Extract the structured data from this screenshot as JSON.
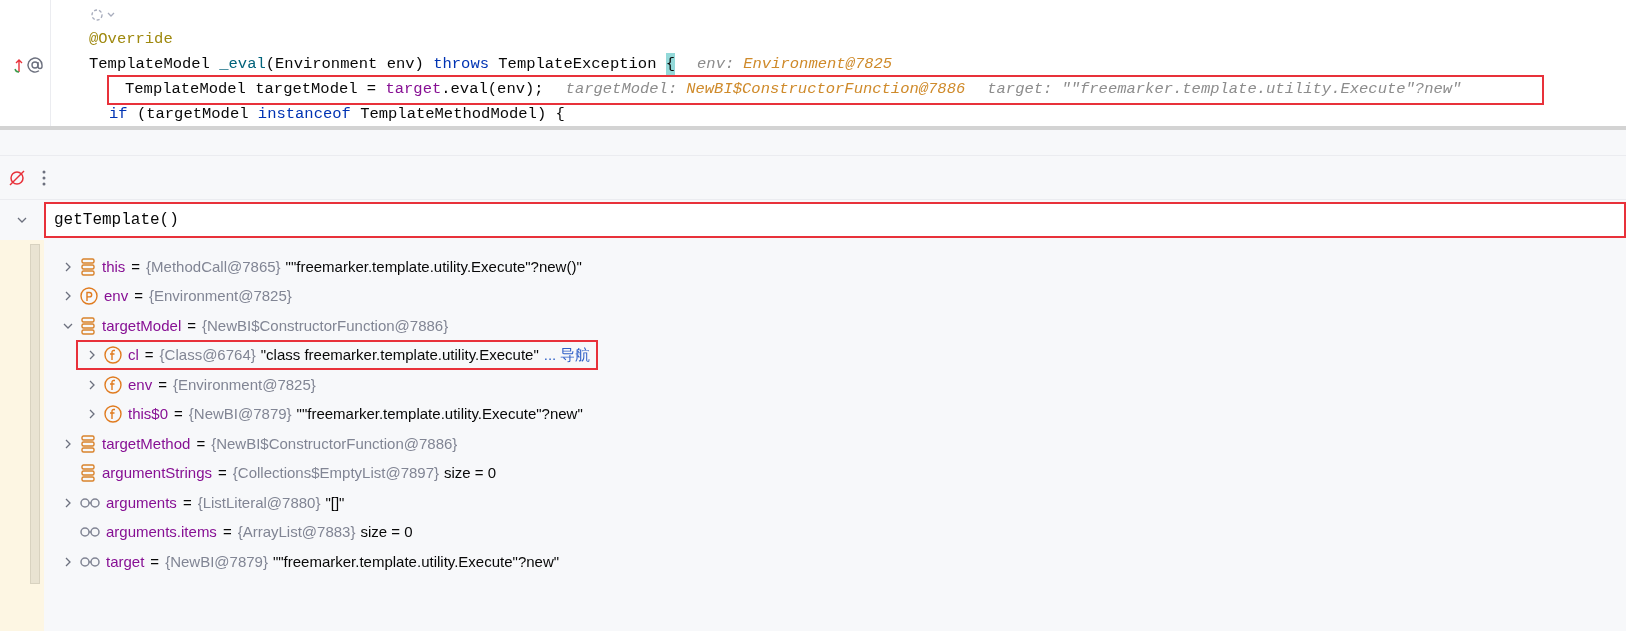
{
  "editor": {
    "lines": [
      {
        "annotated": false,
        "fold_icon": true
      },
      {
        "annotated": false,
        "tokens": [
          {
            "kind": "annotation",
            "text": "@Override"
          }
        ]
      },
      {
        "annotated": false,
        "override_marker": true,
        "tokens": [
          {
            "kind": "plain",
            "text": "TemplateModel "
          },
          {
            "kind": "method",
            "text": "_eval"
          },
          {
            "kind": "plain",
            "text": "(Environment env) "
          },
          {
            "kind": "keyword",
            "text": "throws"
          },
          {
            "kind": "plain",
            "text": " TemplateException "
          },
          {
            "kind": "brace",
            "text": "{"
          }
        ],
        "hints": [
          {
            "label": "env:",
            "value": "Environment@7825",
            "kind": "object"
          }
        ],
        "children": [
          {
            "annotated": true,
            "tokens": [
              {
                "kind": "plain",
                "text": "TemplateModel targetModel = "
              },
              {
                "kind": "field",
                "text": "target"
              },
              {
                "kind": "plain",
                "text": ".eval(env);"
              }
            ],
            "hints": [
              {
                "label": "targetModel:",
                "value": "NewBI$ConstructorFunction@7886",
                "kind": "object"
              },
              {
                "label": "target:",
                "value": "\"\"freemarker.template.utility.Execute\"?new\"",
                "kind": "string"
              }
            ]
          },
          {
            "annotated": false,
            "tokens": [
              {
                "kind": "keyword",
                "text": "if"
              },
              {
                "kind": "plain",
                "text": " (targetModel "
              },
              {
                "kind": "keyword",
                "text": "instanceof"
              },
              {
                "kind": "plain",
                "text": " TemplateMethodModel) {"
              }
            ]
          }
        ]
      }
    ]
  },
  "evaluate": {
    "value": "getTemplate()",
    "annotated": true
  },
  "variables": [
    {
      "kind": "local",
      "name": "this",
      "equals": "=",
      "ref": "{MethodCall@7865}",
      "value": "\"\"freemarker.template.utility.Execute\"?new()\"",
      "expandable": true,
      "expanded": false,
      "annotated": false
    },
    {
      "kind": "param",
      "name": "env",
      "equals": "=",
      "ref": "{Environment@7825}",
      "expandable": true,
      "expanded": false,
      "annotated": false
    },
    {
      "kind": "local",
      "name": "targetModel",
      "equals": "=",
      "ref": "{NewBI$ConstructorFunction@7886}",
      "expandable": true,
      "expanded": true,
      "annotated": false,
      "children": [
        {
          "kind": "field",
          "name": "cl",
          "equals": "=",
          "ref": "{Class@6764}",
          "value": "\"class freemarker.template.utility.Execute\"",
          "link": "... 导航",
          "expandable": true,
          "expanded": false,
          "annotated": true
        },
        {
          "kind": "field",
          "name": "env",
          "equals": "=",
          "ref": "{Environment@7825}",
          "expandable": true,
          "expanded": false,
          "annotated": false
        },
        {
          "kind": "field",
          "name": "this$0",
          "equals": "=",
          "ref": "{NewBI@7879}",
          "value": "\"\"freemarker.template.utility.Execute\"?new\"",
          "expandable": true,
          "expanded": false,
          "annotated": false
        }
      ]
    },
    {
      "kind": "local",
      "name": "targetMethod",
      "equals": "=",
      "ref": "{NewBI$ConstructorFunction@7886}",
      "expandable": true,
      "expanded": false,
      "annotated": false
    },
    {
      "kind": "local",
      "name": "argumentStrings",
      "equals": "=",
      "ref": "{Collections$EmptyList@7897}",
      "value": "size = 0",
      "expandable": false,
      "annotated": false
    },
    {
      "kind": "watch",
      "name": "arguments",
      "equals": "=",
      "ref": "{ListLiteral@7880}",
      "value": "\"[]\"",
      "expandable": true,
      "expanded": false,
      "annotated": false
    },
    {
      "kind": "watch",
      "name": "arguments.items",
      "equals": "=",
      "ref": "{ArrayList@7883}",
      "value": "size = 0",
      "expandable": false,
      "annotated": false
    },
    {
      "kind": "watch",
      "name": "target",
      "equals": "=",
      "ref": "{NewBI@7879}",
      "value": "\"\"freemarker.template.utility.Execute\"?new\"",
      "expandable": true,
      "expanded": false,
      "annotated": false
    }
  ]
}
